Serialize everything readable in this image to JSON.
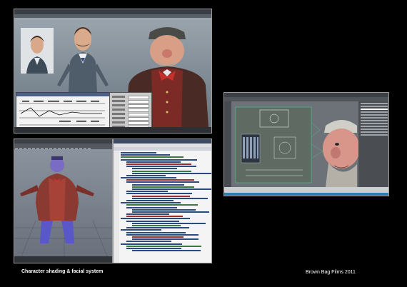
{
  "captions": {
    "left": "Character shading & facial system",
    "right": "Brown Bag Films 2011"
  },
  "screenshots": [
    {
      "name": "character-shading-viewport",
      "app": "3D animation software",
      "content": "Shaded characters with reference photo and graph editor"
    },
    {
      "name": "character-model-viewport",
      "app": "3D animation software",
      "content": "Full-body character in wireframe-shaded view"
    },
    {
      "name": "script-editor",
      "app": "code editor",
      "content": "Rig setup script"
    },
    {
      "name": "facial-rig-viewport",
      "app": "3D animation software",
      "content": "Facial control board and character head"
    }
  ],
  "colors": {
    "background": "#000000",
    "caption": "#ffffff",
    "status_bar": "#2d7fb0"
  }
}
